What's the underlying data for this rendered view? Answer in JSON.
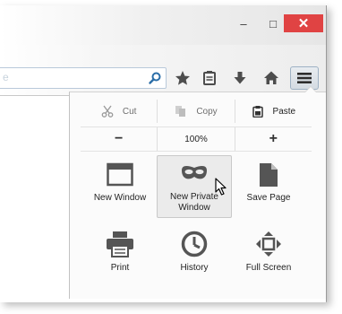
{
  "window": {
    "minimize_glyph": "–",
    "maximize_glyph": "□",
    "close_glyph": "✕"
  },
  "urlbar": {
    "value": "e"
  },
  "toolbar": {
    "icons": [
      "star-icon",
      "reading-list-icon",
      "download-icon",
      "home-icon",
      "menu-icon"
    ]
  },
  "menu": {
    "edit": {
      "cut": "Cut",
      "copy": "Copy",
      "paste": "Paste"
    },
    "zoom": {
      "minus": "−",
      "level": "100%",
      "plus": "+"
    },
    "items": [
      {
        "label": "New Window",
        "icon": "new-window-icon"
      },
      {
        "label": "New Private\nWindow",
        "icon": "private-mask-icon"
      },
      {
        "label": "Save Page",
        "icon": "save-page-icon"
      },
      {
        "label": "Print",
        "icon": "printer-icon"
      },
      {
        "label": "History",
        "icon": "history-clock-icon"
      },
      {
        "label": "Full Screen",
        "icon": "full-screen-icon"
      }
    ]
  },
  "colors": {
    "close_button": "#e04343",
    "icon": "#555555",
    "menu_accent": "#9eb1c4"
  }
}
